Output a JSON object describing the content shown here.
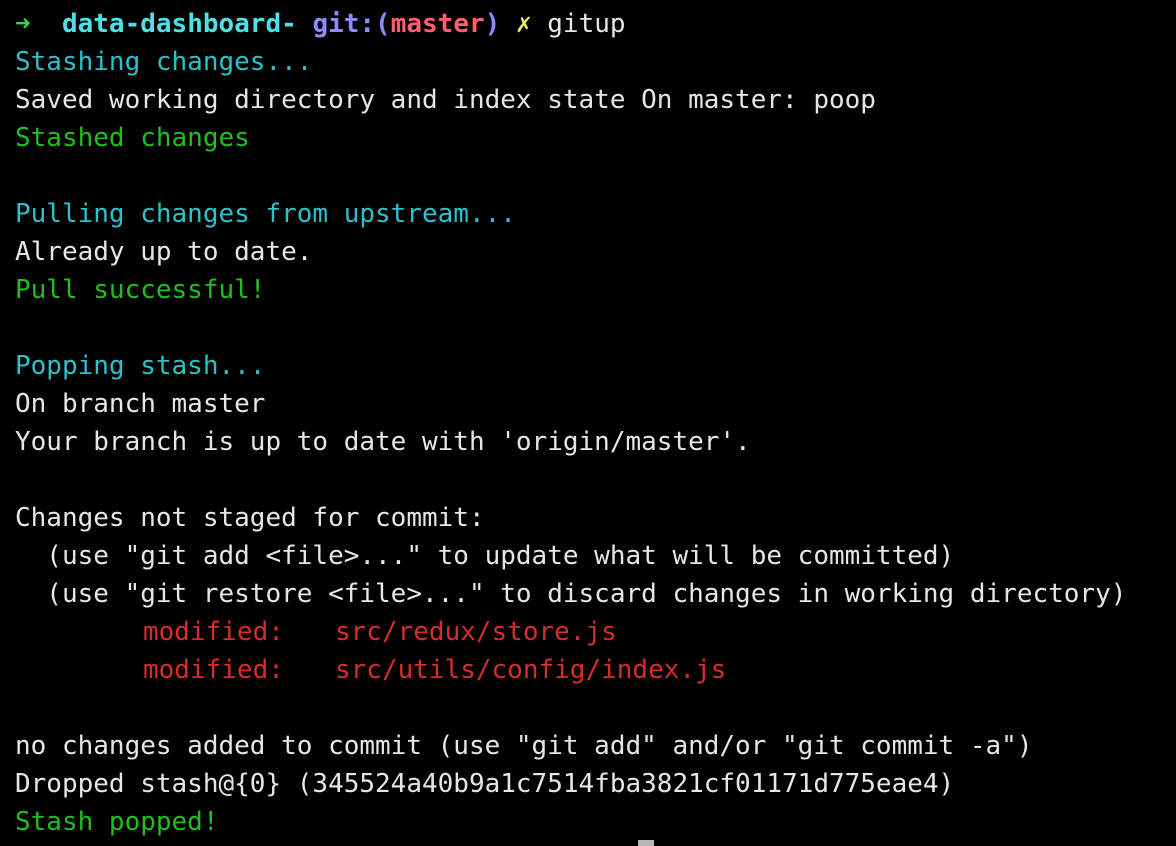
{
  "colors": {
    "background": "#000000",
    "info": "#2cc1c9",
    "success": "#1fbf1f",
    "modified": "#d72c2c",
    "text": "#e6e6e6"
  },
  "prompt": {
    "arrow": "➜",
    "directory": "data-dashboard-",
    "git_prefix": "git:(",
    "branch": "master",
    "git_suffix": ")",
    "dirty_mark": "✗",
    "command": "gitup"
  },
  "output": {
    "stashing": "Stashing changes...",
    "saved_state": "Saved working directory and index state On master: poop",
    "stashed": "Stashed changes",
    "pulling": "Pulling changes from upstream...",
    "already_up_to_date": "Already up to date.",
    "pull_successful": "Pull successful!",
    "popping": "Popping stash...",
    "on_branch": "On branch master",
    "branch_status": "Your branch is up to date with 'origin/master'.",
    "changes_header": "Changes not staged for commit:",
    "hint_add": "  (use \"git add <file>...\" to update what will be committed)",
    "hint_restore": "  (use \"git restore <file>...\" to discard changes in working directory)",
    "modified_files": [
      {
        "status": "modified:",
        "path": "src/redux/store.js"
      },
      {
        "status": "modified:",
        "path": "src/utils/config/index.js"
      }
    ],
    "no_changes_added": "no changes added to commit (use \"git add\" and/or \"git commit -a\")",
    "dropped_stash": "Dropped stash@{0} (345524a40b9a1c7514fba3821cf01171d775eae4)",
    "stash_popped": "Stash popped!"
  }
}
